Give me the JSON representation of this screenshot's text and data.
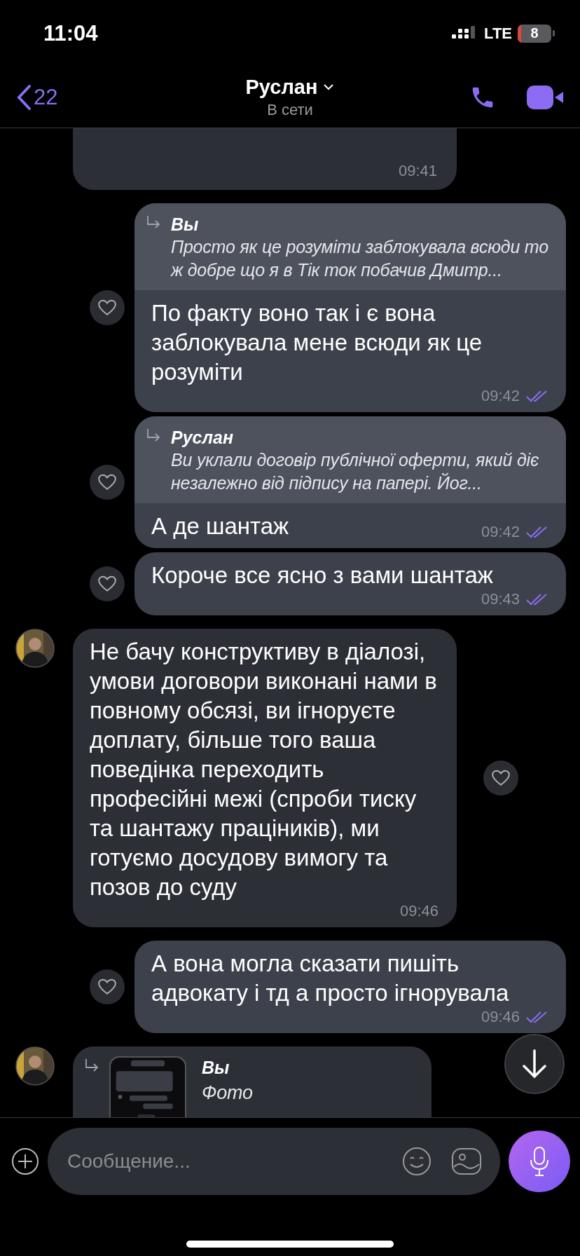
{
  "status_bar": {
    "time": "11:04",
    "network": "LTE",
    "battery": "8"
  },
  "header": {
    "back_count": "22",
    "title": "Руслан",
    "subtitle": "В сети"
  },
  "messages": [
    {
      "kind": "incoming",
      "avatar": false,
      "time": "09:41",
      "reactions": false
    },
    {
      "kind": "outgoing",
      "reply": {
        "kind": "text",
        "author": "Вы",
        "text": "Просто як це розуміти заблокувала всюди то ж добре що я в Тік ток побачив Дмитр..."
      },
      "text": "По факту воно так і є вона заблокувала мене всюди як це розуміти",
      "time": "09:42",
      "read": true,
      "reactions": true
    },
    {
      "kind": "outgoing",
      "reply": {
        "kind": "text",
        "author": "Руслан",
        "text": "Ви уклали договір публічної оферти, який діє незалежно від підпису на папері. Йог..."
      },
      "text": "А де шантаж",
      "time": "09:42",
      "read": true,
      "reactions": true
    },
    {
      "kind": "outgoing",
      "text": "Короче все ясно з вами шантаж",
      "time": "09:43",
      "read": true,
      "reactions": true
    },
    {
      "kind": "incoming",
      "avatar": true,
      "text": "Не бачу конструктиву в діалозі, умови договори виконані нами в повному обсязі, ви ігноруєте доплату, більше того ваша поведінка переходить професійні межі (спроби тиску та шантажу праціників), ми готуємо досудову вимогу та позов до суду",
      "time": "09:46",
      "reactions": true
    },
    {
      "kind": "outgoing",
      "text": "А вона могла сказати пишіть адвокату і тд а просто ігнорувала",
      "time": "09:46",
      "read": true,
      "reactions": true
    },
    {
      "kind": "incoming",
      "avatar": true,
      "reply": {
        "author": "Вы",
        "text": "Фото"
      },
      "reactions": false
    }
  ],
  "composer": {
    "placeholder": "Сообщение..."
  }
}
